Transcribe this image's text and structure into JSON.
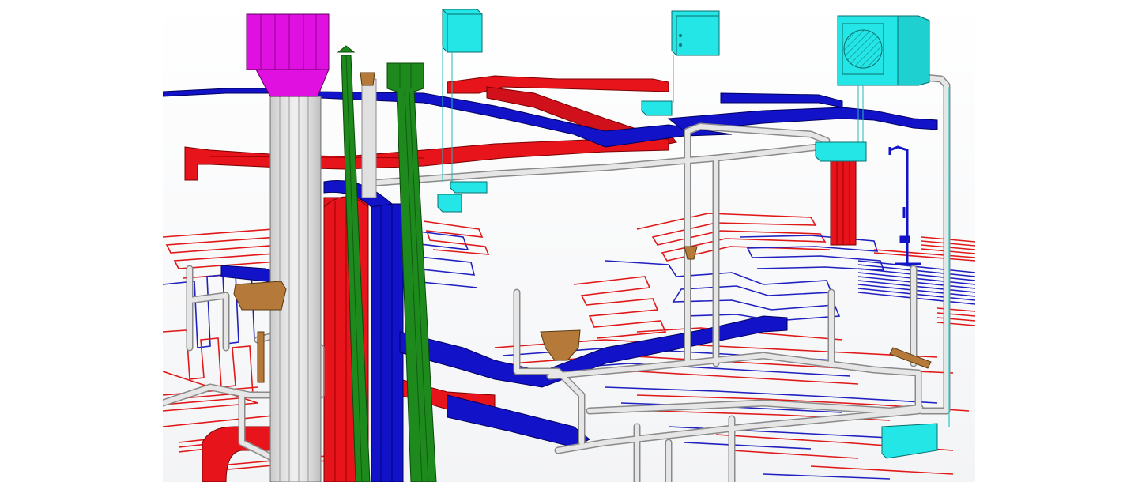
{
  "scene": {
    "kind": "3d-mep-model",
    "colors": {
      "supply_duct": "#e8141c",
      "return_duct": "#1212c8",
      "water_pipe": "#d9d9d9",
      "pipe_outline": "#8a8a8a",
      "exhaust_stack": "#1e8a1e",
      "chimney_cap": "#e010e0",
      "indoor_unit": "#25e6e6",
      "valve": "#b5793a",
      "floor_heating_hot": "#e01818",
      "floor_heating_cold": "#2020c0"
    },
    "icons": [
      "ac-outdoor-unit-fan-icon",
      "wall-mounted-ac-unit-icon",
      "valve-icon",
      "shower-icon"
    ]
  }
}
